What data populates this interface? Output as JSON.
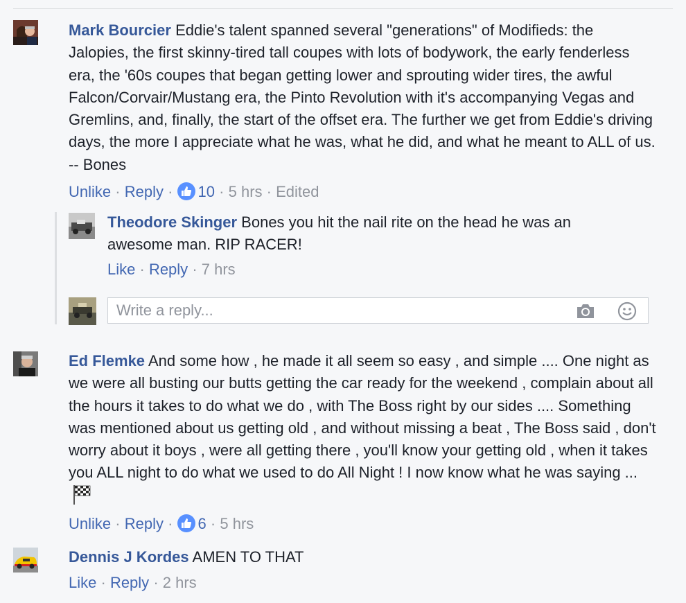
{
  "comments": [
    {
      "author": "Mark Bourcier",
      "text": "Eddie's talent spanned several \"generations\" of Modifieds: the Jalopies, the first skinny-tired tall coupes with lots of bodywork, the early fenderless era, the '60s coupes that began getting lower and sprouting wider tires, the awful Falcon/Corvair/Mustang era, the Pinto Revolution with it's accompanying Vegas and Gremlins, and, finally, the start of the offset era. The further we get from Eddie's driving days, the more I appreciate what he was, what he did, and what he meant to ALL of us. -- Bones",
      "like_label": "Unlike",
      "reply_label": "Reply",
      "like_count": "10",
      "time": "5 hrs",
      "edited": "Edited",
      "replies": [
        {
          "author": "Theodore Skinger",
          "text": "Bones you hit the nail rite on the head he was an awesome man. RIP RACER!",
          "like_label": "Like",
          "reply_label": "Reply",
          "time": "7 hrs"
        }
      ],
      "reply_box": {
        "placeholder": "Write a reply..."
      }
    },
    {
      "author": "Ed Flemke",
      "text": "And some how , he made it all seem so easy , and simple .... One night as we were all busting our butts getting the car ready for the weekend , complain about all the hours it takes to do what we do , with The Boss right by our sides .... Something was mentioned about us getting old , and without missing a beat , The Boss said , don't worry about it boys , were all getting there , you'll know your getting old , when it takes you ALL night to do what we used to do All Night ! I now know what he was saying ...",
      "emoji": "checkered-flag",
      "like_label": "Unlike",
      "reply_label": "Reply",
      "like_count": "6",
      "time": "5 hrs"
    },
    {
      "author": "Dennis J Kordes",
      "text": "AMEN TO THAT",
      "like_label": "Like",
      "reply_label": "Reply",
      "time": "2 hrs"
    }
  ],
  "separator": "·",
  "colors": {
    "link": "#4267b2",
    "name": "#365899",
    "meta": "#90949c",
    "like_badge": "#5890ff"
  },
  "icons": [
    "thumbs-up-icon",
    "camera-icon",
    "smiley-icon",
    "checkered-flag-icon"
  ]
}
